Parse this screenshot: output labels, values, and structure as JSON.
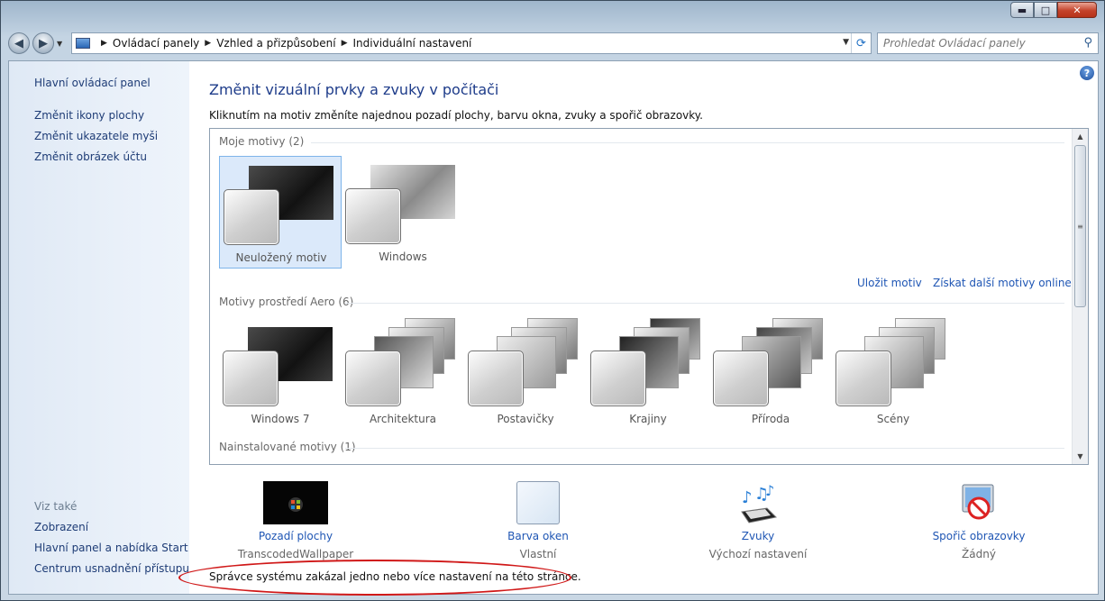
{
  "window": {
    "caption_buttons": {
      "minimize": "▬",
      "maximize": "□",
      "close": "✕"
    }
  },
  "navbar": {
    "back_glyph": "◀",
    "forward_glyph": "▶",
    "breadcrumbs": [
      "Ovládací panely",
      "Vzhled a přizpůsobení",
      "Individuální nastavení"
    ],
    "search_placeholder": "Prohledat Ovládací panely"
  },
  "sidebar": {
    "home": "Hlavní ovládací panel",
    "links": [
      "Změnit ikony plochy",
      "Změnit ukazatele myši",
      "Změnit obrázek účtu"
    ],
    "see_also": "Viz také",
    "see_also_links": [
      "Zobrazení",
      "Hlavní panel a nabídka Start",
      "Centrum usnadnění přístupu"
    ]
  },
  "main": {
    "title": "Změnit vizuální prvky a zvuky v počítači",
    "lead": "Kliknutím na motiv změníte najednou pozadí plochy, barvu okna, zvuky a spořič obrazovky.",
    "groups": {
      "my": "Moje motivy (2)",
      "aero": "Motivy prostředí Aero (6)",
      "installed": "Nainstalované motivy (1)"
    },
    "my_themes": [
      "Neuložený motiv",
      "Windows"
    ],
    "aero_themes": [
      "Windows 7",
      "Architektura",
      "Postavičky",
      "Krajiny",
      "Příroda",
      "Scény"
    ],
    "links": {
      "save": "Uložit motiv",
      "online": "Získat další motivy online"
    }
  },
  "bottom": [
    {
      "link": "Pozadí plochy",
      "sub": "TranscodedWallpaper"
    },
    {
      "link": "Barva oken",
      "sub": "Vlastní"
    },
    {
      "link": "Zvuky",
      "sub": "Výchozí nastavení"
    },
    {
      "link": "Spořič obrazovky",
      "sub": "Žádný"
    }
  ],
  "warning": "Správce systému zakázal jedno nebo více nastavení na této stránce."
}
